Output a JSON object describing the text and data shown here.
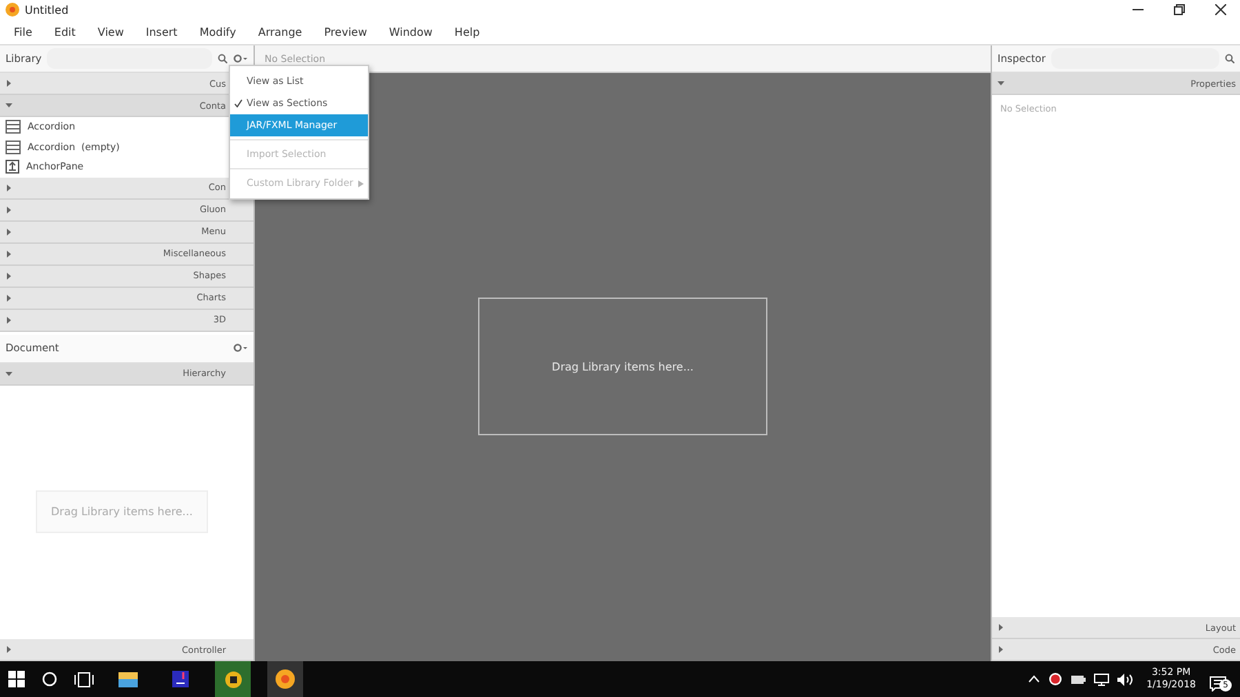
{
  "window": {
    "title": "Untitled"
  },
  "menu_bar": [
    "File",
    "Edit",
    "View",
    "Insert",
    "Modify",
    "Arrange",
    "Preview",
    "Window",
    "Help"
  ],
  "library": {
    "title": "Library",
    "sections": [
      {
        "label": "Cus",
        "expanded": false
      },
      {
        "label": "Conta",
        "expanded": true,
        "items": [
          {
            "label": "Accordion",
            "kind": "rows"
          },
          {
            "label": "Accordion  (empty)",
            "kind": "rows"
          },
          {
            "label": "AnchorPane",
            "kind": "anchor"
          }
        ]
      },
      {
        "label": "Con",
        "expanded": false
      },
      {
        "label": "Gluon",
        "expanded": false
      },
      {
        "label": "Menu",
        "expanded": false
      },
      {
        "label": "Miscellaneous",
        "expanded": false
      },
      {
        "label": "Shapes",
        "expanded": false
      },
      {
        "label": "Charts",
        "expanded": false
      },
      {
        "label": "3D",
        "expanded": false
      }
    ]
  },
  "library_menu": [
    {
      "label": "View as List",
      "checked": false,
      "selected": false,
      "disabled": false,
      "submenu": false
    },
    {
      "label": "View as Sections",
      "checked": true,
      "selected": false,
      "disabled": false,
      "submenu": false
    },
    {
      "label": "JAR/FXML Manager",
      "checked": false,
      "selected": true,
      "disabled": false,
      "submenu": false
    },
    {
      "label": "Import Selection",
      "checked": false,
      "selected": false,
      "disabled": true,
      "submenu": false
    },
    {
      "label": "Custom Library Folder",
      "checked": false,
      "selected": false,
      "disabled": true,
      "submenu": true
    }
  ],
  "document": {
    "title": "Document",
    "section": {
      "label": "Hierarchy",
      "expanded": true
    },
    "drop_hint": "Drag Library items here...",
    "controller": {
      "label": "Controller",
      "expanded": false
    }
  },
  "canvas": {
    "selection": "No Selection",
    "drop_hint": "Drag Library items here..."
  },
  "inspector": {
    "title": "Inspector",
    "section": {
      "label": "Properties",
      "expanded": true
    },
    "selection": "No Selection",
    "bottom_sections": [
      {
        "label": "Layout",
        "expanded": false
      },
      {
        "label": "Code",
        "expanded": false
      }
    ]
  },
  "taskbar": {
    "time": "3:52 PM",
    "date": "1/19/2018",
    "notifications": "5"
  }
}
